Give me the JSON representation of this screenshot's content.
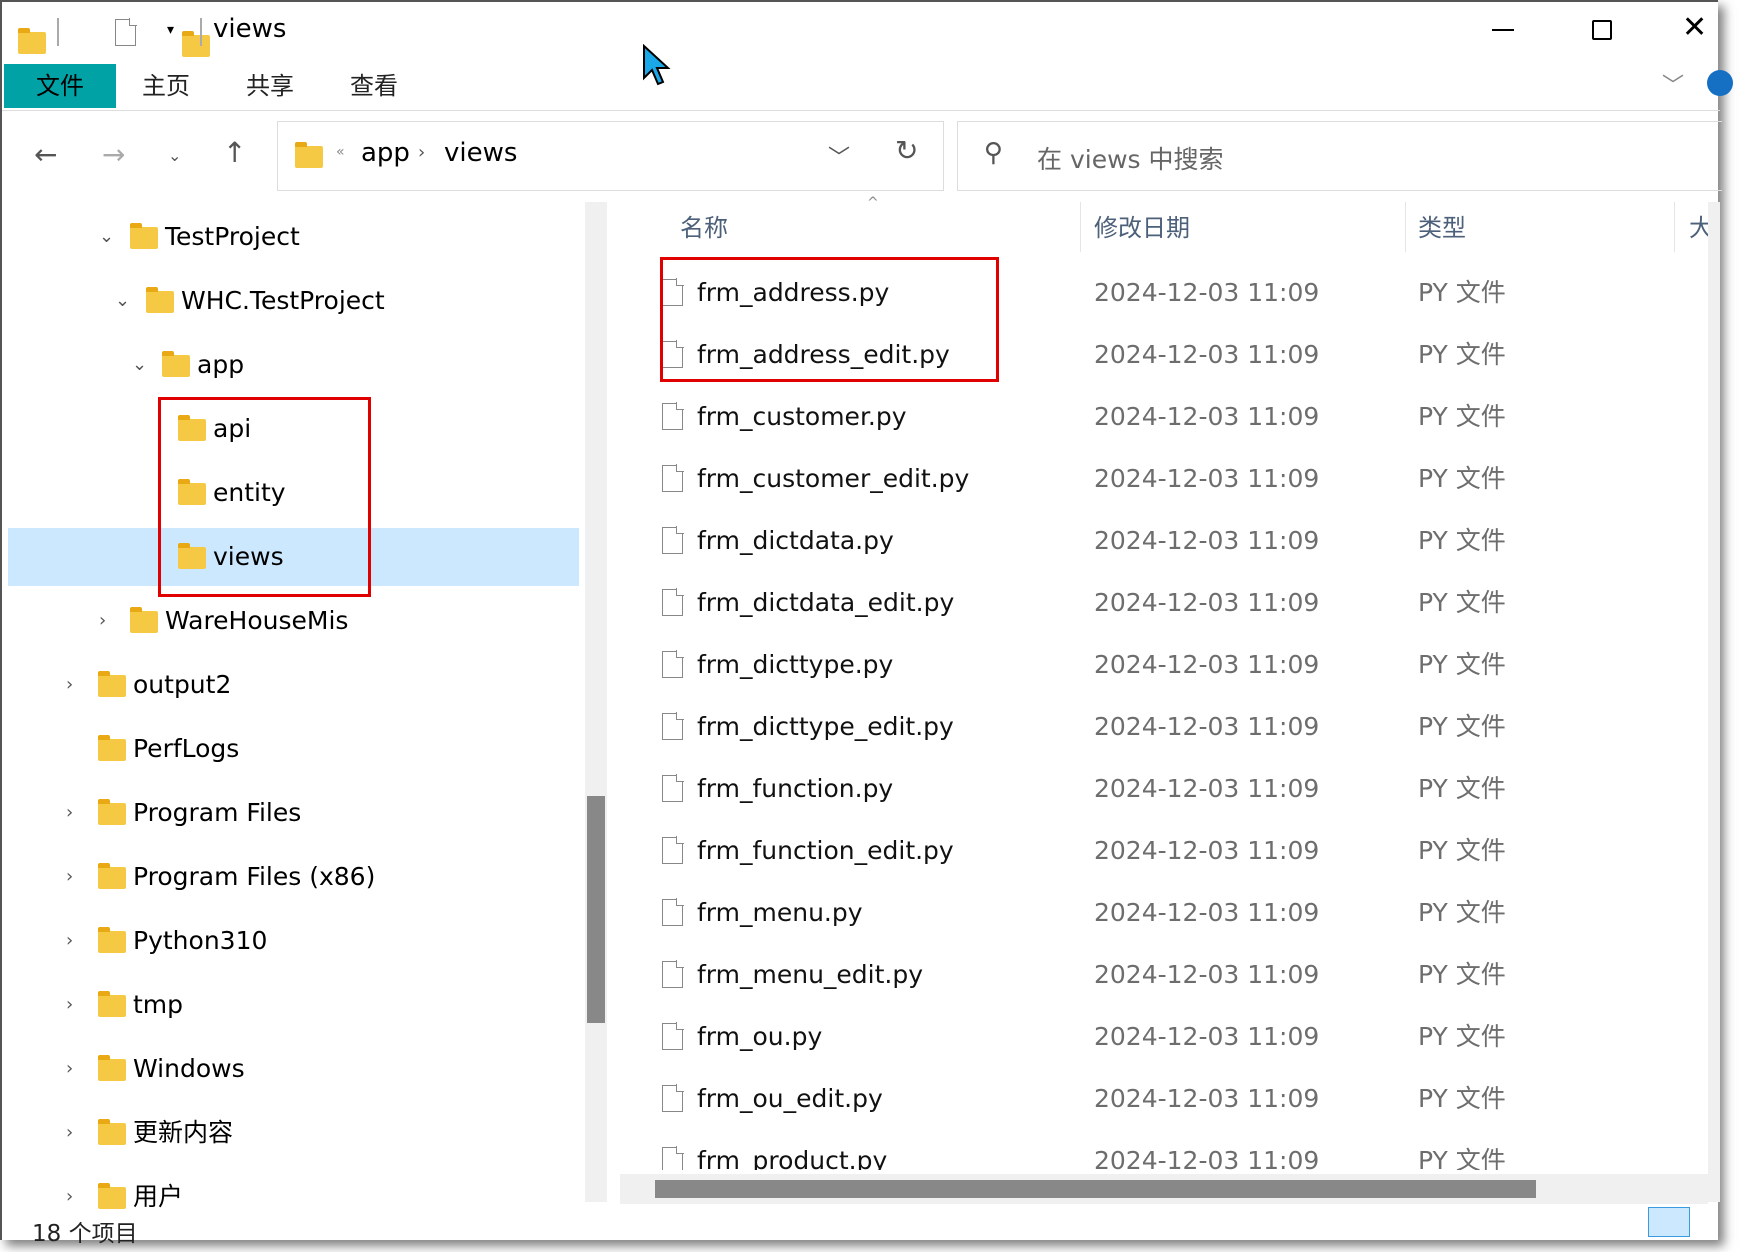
{
  "title": "views",
  "ribbon": {
    "tabs": [
      "文件",
      "主页",
      "共享",
      "查看"
    ]
  },
  "nav": {
    "breadcrumb": [
      "app",
      "views"
    ],
    "overflow": "«",
    "search_placeholder": "在 views 中搜索"
  },
  "tree": [
    {
      "label": "TestProject",
      "expanded": true
    },
    {
      "label": "WHC.TestProject",
      "expanded": true
    },
    {
      "label": "app",
      "expanded": true
    },
    {
      "label": "api"
    },
    {
      "label": "entity"
    },
    {
      "label": "views",
      "selected": true
    },
    {
      "label": "WareHouseMis",
      "expandable": true
    },
    {
      "label": "output2",
      "expandable": true
    },
    {
      "label": "PerfLogs"
    },
    {
      "label": "Program Files",
      "expandable": true
    },
    {
      "label": "Program Files (x86)",
      "expandable": true
    },
    {
      "label": "Python310",
      "expandable": true
    },
    {
      "label": "tmp",
      "expandable": true
    },
    {
      "label": "Windows",
      "expandable": true
    },
    {
      "label": "更新内容",
      "expandable": true
    },
    {
      "label": "用户",
      "expandable": true
    }
  ],
  "columns": [
    "名称",
    "修改日期",
    "类型",
    "大"
  ],
  "files": [
    {
      "name": "frm_address.py",
      "date": "2024-12-03  11:09",
      "type": "PY 文件"
    },
    {
      "name": "frm_address_edit.py",
      "date": "2024-12-03  11:09",
      "type": "PY 文件"
    },
    {
      "name": "frm_customer.py",
      "date": "2024-12-03  11:09",
      "type": "PY 文件"
    },
    {
      "name": "frm_customer_edit.py",
      "date": "2024-12-03  11:09",
      "type": "PY 文件"
    },
    {
      "name": "frm_dictdata.py",
      "date": "2024-12-03  11:09",
      "type": "PY 文件"
    },
    {
      "name": "frm_dictdata_edit.py",
      "date": "2024-12-03  11:09",
      "type": "PY 文件"
    },
    {
      "name": "frm_dicttype.py",
      "date": "2024-12-03  11:09",
      "type": "PY 文件"
    },
    {
      "name": "frm_dicttype_edit.py",
      "date": "2024-12-03  11:09",
      "type": "PY 文件"
    },
    {
      "name": "frm_function.py",
      "date": "2024-12-03  11:09",
      "type": "PY 文件"
    },
    {
      "name": "frm_function_edit.py",
      "date": "2024-12-03  11:09",
      "type": "PY 文件"
    },
    {
      "name": "frm_menu.py",
      "date": "2024-12-03  11:09",
      "type": "PY 文件"
    },
    {
      "name": "frm_menu_edit.py",
      "date": "2024-12-03  11:09",
      "type": "PY 文件"
    },
    {
      "name": "frm_ou.py",
      "date": "2024-12-03  11:09",
      "type": "PY 文件"
    },
    {
      "name": "frm_ou_edit.py",
      "date": "2024-12-03  11:09",
      "type": "PY 文件"
    },
    {
      "name": "frm_product.py",
      "date": "2024-12-03  11:09",
      "type": "PY 文件"
    }
  ],
  "status": {
    "count": "18 个项目"
  },
  "colors": {
    "accent": "#00a2a6",
    "selection": "#cce8ff",
    "highlight": "#e00000"
  }
}
